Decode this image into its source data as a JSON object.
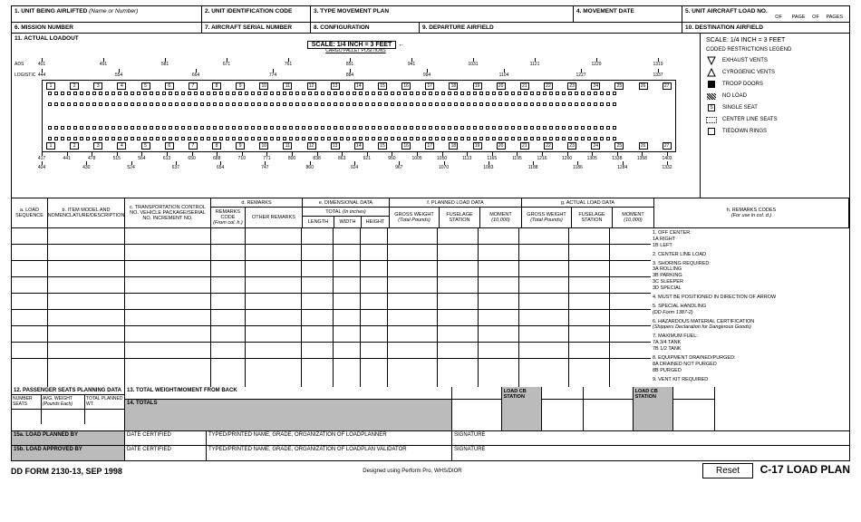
{
  "header": {
    "f1": "1. UNIT BEING AIRLIFTED",
    "f1_note": "(Name or Number)",
    "f2": "2. UNIT IDENTIFICATION CODE",
    "f3": "3. TYPE MOVEMENT PLAN",
    "f4": "4. MOVEMENT DATE",
    "f5": "5. UNIT AIRCRAFT LOAD NO.",
    "f5_of": "OF",
    "f5_page": "PAGE",
    "f5_of2": "OF",
    "f5_pages": "PAGES",
    "f6": "6. MISSION NUMBER",
    "f7": "7. AIRCRAFT SERIAL NUMBER",
    "f8": "8. CONFIGURATION",
    "f9": "9. DEPARTURE AIRFIELD",
    "f10": "10. DESTINATION AIRFIELD",
    "f11": "11. ACTUAL LOADOUT"
  },
  "diagram": {
    "scale": "SCALE: 1/4 INCH = 3 FEET",
    "cargo_label": "CARGO PALLET POSITIONS",
    "ads": "ADS",
    "logistic": "LOGISTIC",
    "ads_ticks": [
      "401",
      "491",
      "581",
      "671",
      "761",
      "851",
      "941",
      "1031",
      "1121",
      "1229",
      "1319"
    ],
    "log_ticks": [
      "444",
      "554",
      "664",
      "774",
      "884",
      "994",
      "1104",
      "1227",
      "1337"
    ],
    "row_nums_top": [
      "1",
      "2",
      "3",
      "4",
      "5",
      "6",
      "7",
      "8",
      "9",
      "10",
      "11",
      "12",
      "13",
      "14",
      "15",
      "16",
      "17",
      "18",
      "19",
      "20",
      "21",
      "22",
      "23",
      "24",
      "25",
      "26",
      "27"
    ],
    "bottom_ticks": [
      "417",
      "441",
      "478",
      "515",
      "564",
      "613",
      "650",
      "688",
      "710",
      "771",
      "800",
      "838",
      "863",
      "921",
      "950",
      "1005",
      "1050",
      "1113",
      "1165",
      "1195",
      "1216",
      "1260",
      "1305",
      "1338",
      "1358",
      "1403"
    ],
    "bottom_ticks2": [
      "404",
      "430",
      "524",
      "637",
      "654",
      "747",
      "860",
      "924",
      "967",
      "1070",
      "1083",
      "1188",
      "1186",
      "1284",
      "1332"
    ]
  },
  "legend": {
    "scale": "SCALE: 1/4 INCH = 3 FEET",
    "title": "CODED RESTRICTIONS LEGEND",
    "items": [
      {
        "sym": "tri-down",
        "text": "EXHAUST VENTS"
      },
      {
        "sym": "tri-up",
        "text": "CYROGENIC VENTS"
      },
      {
        "sym": "sq-filled",
        "text": "TROOP DOORS"
      },
      {
        "sym": "sq-hatch",
        "text": "NO LOAD"
      },
      {
        "sym": "sq-s",
        "text": "SINGLE SEAT"
      },
      {
        "sym": "sq-dot",
        "text": "CENTER LINE SEATS"
      },
      {
        "sym": "sq-open",
        "text": "TIEDOWN RINGS"
      }
    ]
  },
  "cols": {
    "a": "a. LOAD SEQUENCE",
    "b": "b. ITEM MODEL AND NOMENCLATURE/DESCRIPTION",
    "c": "c. TRANSPORTATION CONTROL NO. VEHICLE PACKAGE/SERIAL NO. INCREMENT NO.",
    "d": "d. REMARKS",
    "d1": "REMARKS CODE",
    "d1_note": "(From col. h.)",
    "d2": "OTHER REMARKS",
    "e": "e. DIMENSIONAL DATA",
    "e_total": "TOTAL",
    "e_note": "(In inches)",
    "e1": "LENGTH",
    "e2": "WIDTH",
    "e3": "HEIGHT",
    "f": "f. PLANNED LOAD DATA",
    "f1": "GROSS WEIGHT",
    "f1_note": "(Total Pounds)",
    "f2": "FUSELAGE STATION",
    "f3": "MOMENT",
    "f3_note": "(10,000)",
    "g": "g. ACTUAL LOAD DATA",
    "g1": "GROSS WEIGHT",
    "g1_note": "(Total Pounds)",
    "g2": "FUSELAGE STATION",
    "g3": "MOMENT",
    "g3_note": "(10,000)",
    "h": "h. REMARKS CODES",
    "h_note": "(For use in col. d.)"
  },
  "remarks": {
    "r1": "1. OFF CENTER:",
    "r1a": "1A RIGHT",
    "r1b": "1B LEFT",
    "r2": "2. CENTER LINE LOAD",
    "r3": "3. SHORING REQUIRED:",
    "r3a": "3A ROLLING",
    "r3b": "3B PARKING",
    "r3c": "3C SLEEPER",
    "r3d": "3D SPECIAL",
    "r4": "4. MUST BE POSITIONED IN DIRECTION OF ARROW",
    "r5": "5. SPECIAL HANDLING",
    "r5_note": "(DD Form 1387-2)",
    "r6": "6. HAZARDOUS MATERIAL CERTIFICATION",
    "r6_note": "(Shippers Declaration for Dangerous Goods)",
    "r7": "7. MAXIMUM FUEL:",
    "r7a": "7A 3/4 TANK",
    "r7b": "7B 1/2 TANK",
    "r8": "8. EQUIPMENT DRAINED/PURGED:",
    "r8a": "8A DRAINED NOT PURGED",
    "r8b": "8B PURGED",
    "r9": "9. VENT KIT REQUIRED"
  },
  "bottom": {
    "f12": "12. PASSENGER SEATS PLANNING DATA",
    "seats_num": "NUMBER SEATS",
    "seats_avg": "AVG. WEIGHT",
    "seats_avg_note": "(Pounds Each)",
    "seats_tp": "TOTAL PLANNED WT.",
    "f13": "13. TOTAL WEIGHT/MOMENT FROM BACK",
    "f14": "14. TOTALS",
    "load_cb": "LOAD CB STATION",
    "f15a": "15a. LOAD PLANNED BY",
    "f15b": "15b. LOAD APPROVED BY",
    "date_cert": "DATE CERTIFIED",
    "typed_a": "TYPED/PRINTED NAME, GRADE, ORGANIZATION OF LOADPLANNER",
    "typed_b": "TYPED/PRINTED NAME, GRADE, ORGANIZATION OF LOADPLAN VALIDATOR",
    "sig": "SIGNATURE"
  },
  "footer": {
    "form": "DD FORM 2130-13, SEP 1998",
    "design": "Designed using Perform Pro, WHS/DIOR",
    "reset": "Reset",
    "title": "C-17 LOAD PLAN"
  }
}
